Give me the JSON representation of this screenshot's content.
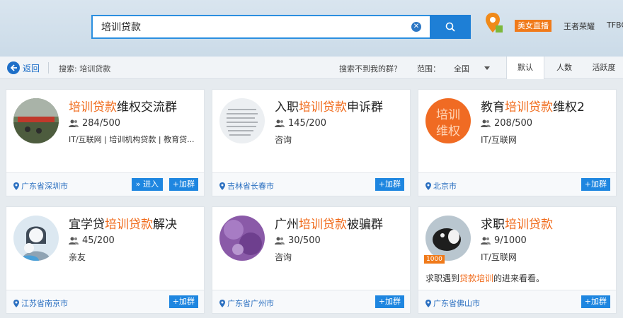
{
  "search": {
    "value": "培训贷款"
  },
  "top": {
    "live_label": "美女直播",
    "user": "王者荣耀",
    "extra": "TFBOYS"
  },
  "filter": {
    "back_label": "返回",
    "search_prefix": "搜索: 培训贷款",
    "not_found": "搜索不到我的群？",
    "range_label": "范围：",
    "range_value": "全国",
    "sort_tabs": [
      "默认",
      "人数",
      "活跃度"
    ]
  },
  "buttons": {
    "join": "+加群",
    "enter": "» 进入"
  },
  "cards": [
    {
      "title_pre": "",
      "title_hl": "培训贷款",
      "title_post": "维权交流群",
      "members": "284/500",
      "tags": "IT/互联网 | 培训机构贷款 | 教育贷...",
      "location": "广东省深圳市",
      "has_enter": true
    },
    {
      "title_pre": "入职",
      "title_hl": "培训贷款",
      "title_post": "申诉群",
      "members": "145/200",
      "tags": "咨询",
      "location": "吉林省长春市",
      "has_enter": false
    },
    {
      "title_pre": "教育",
      "title_hl": "培训贷款",
      "title_post": "维权2",
      "members": "208/500",
      "tags": "IT/互联网",
      "location": "北京市",
      "has_enter": false,
      "avatar_text": "培训维权"
    },
    {
      "title_pre": "宜学贷",
      "title_hl": "培训贷款",
      "title_post": "解决",
      "members": "45/200",
      "tags": "亲友",
      "location": "江苏省南京市",
      "has_enter": false
    },
    {
      "title_pre": "广州",
      "title_hl": "培训贷款",
      "title_post": "被骗群",
      "members": "30/500",
      "tags": "咨询",
      "location": "广东省广州市",
      "has_enter": false
    },
    {
      "title_pre": "求职",
      "title_hl": "培训贷款",
      "title_post": "",
      "members": "9/1000",
      "tags": "IT/互联网",
      "location": "广东省佛山市",
      "has_enter": false,
      "desc_pre": "求职遇到",
      "desc_hl": "贷款培训",
      "desc_post": "的进来看看。",
      "badge": "1000"
    }
  ]
}
